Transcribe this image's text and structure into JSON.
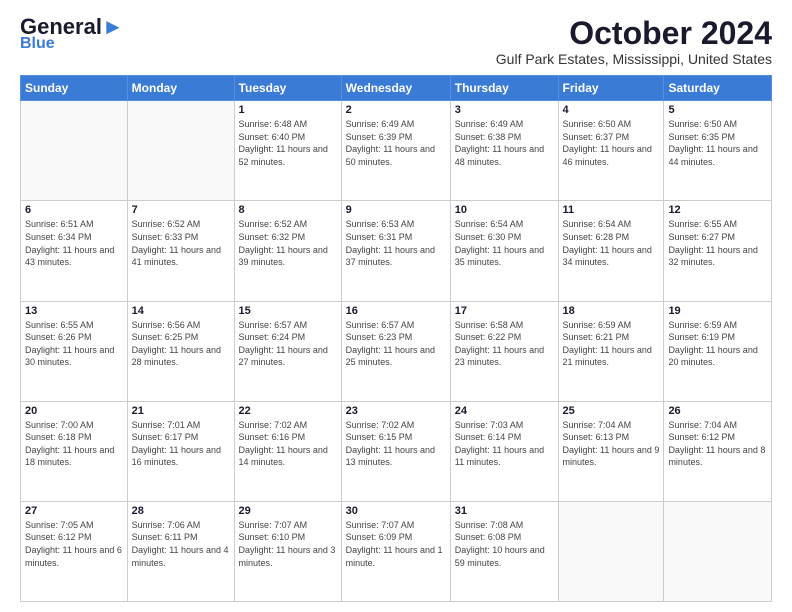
{
  "header": {
    "logo_line1": "General",
    "logo_line2": "Blue",
    "month": "October 2024",
    "location": "Gulf Park Estates, Mississippi, United States"
  },
  "weekdays": [
    "Sunday",
    "Monday",
    "Tuesday",
    "Wednesday",
    "Thursday",
    "Friday",
    "Saturday"
  ],
  "weeks": [
    [
      {
        "day": "",
        "info": ""
      },
      {
        "day": "",
        "info": ""
      },
      {
        "day": "1",
        "info": "Sunrise: 6:48 AM\nSunset: 6:40 PM\nDaylight: 11 hours and 52 minutes."
      },
      {
        "day": "2",
        "info": "Sunrise: 6:49 AM\nSunset: 6:39 PM\nDaylight: 11 hours and 50 minutes."
      },
      {
        "day": "3",
        "info": "Sunrise: 6:49 AM\nSunset: 6:38 PM\nDaylight: 11 hours and 48 minutes."
      },
      {
        "day": "4",
        "info": "Sunrise: 6:50 AM\nSunset: 6:37 PM\nDaylight: 11 hours and 46 minutes."
      },
      {
        "day": "5",
        "info": "Sunrise: 6:50 AM\nSunset: 6:35 PM\nDaylight: 11 hours and 44 minutes."
      }
    ],
    [
      {
        "day": "6",
        "info": "Sunrise: 6:51 AM\nSunset: 6:34 PM\nDaylight: 11 hours and 43 minutes."
      },
      {
        "day": "7",
        "info": "Sunrise: 6:52 AM\nSunset: 6:33 PM\nDaylight: 11 hours and 41 minutes."
      },
      {
        "day": "8",
        "info": "Sunrise: 6:52 AM\nSunset: 6:32 PM\nDaylight: 11 hours and 39 minutes."
      },
      {
        "day": "9",
        "info": "Sunrise: 6:53 AM\nSunset: 6:31 PM\nDaylight: 11 hours and 37 minutes."
      },
      {
        "day": "10",
        "info": "Sunrise: 6:54 AM\nSunset: 6:30 PM\nDaylight: 11 hours and 35 minutes."
      },
      {
        "day": "11",
        "info": "Sunrise: 6:54 AM\nSunset: 6:28 PM\nDaylight: 11 hours and 34 minutes."
      },
      {
        "day": "12",
        "info": "Sunrise: 6:55 AM\nSunset: 6:27 PM\nDaylight: 11 hours and 32 minutes."
      }
    ],
    [
      {
        "day": "13",
        "info": "Sunrise: 6:55 AM\nSunset: 6:26 PM\nDaylight: 11 hours and 30 minutes."
      },
      {
        "day": "14",
        "info": "Sunrise: 6:56 AM\nSunset: 6:25 PM\nDaylight: 11 hours and 28 minutes."
      },
      {
        "day": "15",
        "info": "Sunrise: 6:57 AM\nSunset: 6:24 PM\nDaylight: 11 hours and 27 minutes."
      },
      {
        "day": "16",
        "info": "Sunrise: 6:57 AM\nSunset: 6:23 PM\nDaylight: 11 hours and 25 minutes."
      },
      {
        "day": "17",
        "info": "Sunrise: 6:58 AM\nSunset: 6:22 PM\nDaylight: 11 hours and 23 minutes."
      },
      {
        "day": "18",
        "info": "Sunrise: 6:59 AM\nSunset: 6:21 PM\nDaylight: 11 hours and 21 minutes."
      },
      {
        "day": "19",
        "info": "Sunrise: 6:59 AM\nSunset: 6:19 PM\nDaylight: 11 hours and 20 minutes."
      }
    ],
    [
      {
        "day": "20",
        "info": "Sunrise: 7:00 AM\nSunset: 6:18 PM\nDaylight: 11 hours and 18 minutes."
      },
      {
        "day": "21",
        "info": "Sunrise: 7:01 AM\nSunset: 6:17 PM\nDaylight: 11 hours and 16 minutes."
      },
      {
        "day": "22",
        "info": "Sunrise: 7:02 AM\nSunset: 6:16 PM\nDaylight: 11 hours and 14 minutes."
      },
      {
        "day": "23",
        "info": "Sunrise: 7:02 AM\nSunset: 6:15 PM\nDaylight: 11 hours and 13 minutes."
      },
      {
        "day": "24",
        "info": "Sunrise: 7:03 AM\nSunset: 6:14 PM\nDaylight: 11 hours and 11 minutes."
      },
      {
        "day": "25",
        "info": "Sunrise: 7:04 AM\nSunset: 6:13 PM\nDaylight: 11 hours and 9 minutes."
      },
      {
        "day": "26",
        "info": "Sunrise: 7:04 AM\nSunset: 6:12 PM\nDaylight: 11 hours and 8 minutes."
      }
    ],
    [
      {
        "day": "27",
        "info": "Sunrise: 7:05 AM\nSunset: 6:12 PM\nDaylight: 11 hours and 6 minutes."
      },
      {
        "day": "28",
        "info": "Sunrise: 7:06 AM\nSunset: 6:11 PM\nDaylight: 11 hours and 4 minutes."
      },
      {
        "day": "29",
        "info": "Sunrise: 7:07 AM\nSunset: 6:10 PM\nDaylight: 11 hours and 3 minutes."
      },
      {
        "day": "30",
        "info": "Sunrise: 7:07 AM\nSunset: 6:09 PM\nDaylight: 11 hours and 1 minute."
      },
      {
        "day": "31",
        "info": "Sunrise: 7:08 AM\nSunset: 6:08 PM\nDaylight: 10 hours and 59 minutes."
      },
      {
        "day": "",
        "info": ""
      },
      {
        "day": "",
        "info": ""
      }
    ]
  ]
}
